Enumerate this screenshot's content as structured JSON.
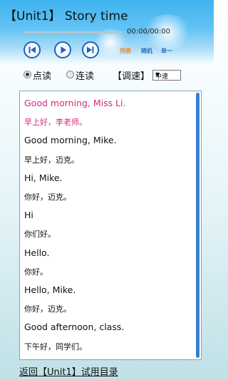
{
  "header": {
    "title": "【Unit1】 Story time"
  },
  "player": {
    "time": "00:00/00:00",
    "progress": 0,
    "buttons": [
      "previous",
      "play",
      "next"
    ],
    "links": [
      {
        "label": "列表",
        "color": "#e8861a"
      },
      {
        "label": "随机",
        "color": "#2d6fc4"
      },
      {
        "label": "单一",
        "color": "#2d6fc4"
      }
    ]
  },
  "options": {
    "mode1": "点读",
    "mode2": "连读",
    "speed_label": "【调速】",
    "speed_value": "中速"
  },
  "lines": [
    {
      "text": "Good morning, Miss Li.",
      "lang": "en",
      "active": true
    },
    {
      "text": "早上好，李老师。",
      "lang": "zh",
      "active": true
    },
    {
      "text": "Good morning, Mike.",
      "lang": "en",
      "active": false
    },
    {
      "text": "早上好，迈克。",
      "lang": "zh",
      "active": false
    },
    {
      "text": "Hi, Mike.",
      "lang": "en",
      "active": false
    },
    {
      "text": "你好，迈克。",
      "lang": "zh",
      "active": false
    },
    {
      "text": "Hi",
      "lang": "en",
      "active": false
    },
    {
      "text": "你们好。",
      "lang": "zh",
      "active": false
    },
    {
      "text": "Hello.",
      "lang": "en",
      "active": false
    },
    {
      "text": "你好。",
      "lang": "zh",
      "active": false
    },
    {
      "text": "Hello, Mike.",
      "lang": "en",
      "active": false
    },
    {
      "text": "你好，迈克。",
      "lang": "zh",
      "active": false
    },
    {
      "text": "Good afternoon, class.",
      "lang": "en",
      "active": false
    },
    {
      "text": "下午好，同学们。",
      "lang": "zh",
      "active": false
    }
  ],
  "footer": {
    "back_link": "返回【Unit1】试用目录"
  }
}
